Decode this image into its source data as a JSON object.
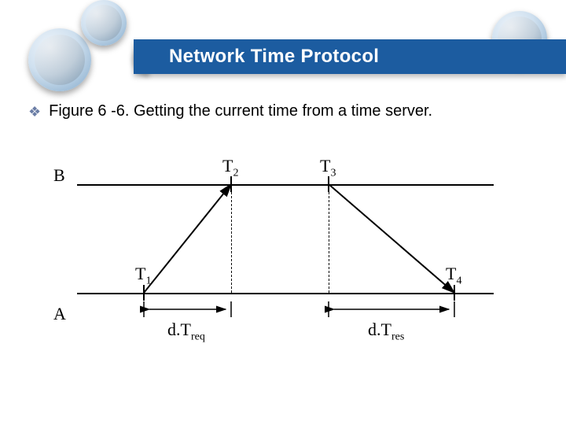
{
  "header": {
    "title": "Network Time Protocol"
  },
  "bullet": {
    "icon": "❖",
    "text": "Figure 6 -6. Getting the current time from a time server."
  },
  "diagram": {
    "node_B": "B",
    "node_A": "A",
    "T1_label": "T",
    "T1_sub": "1",
    "T2_label": "T",
    "T2_sub": "2",
    "T3_label": "T",
    "T3_sub": "3",
    "T4_label": "T",
    "T4_sub": "4",
    "dTreq_label": "d.T",
    "dTreq_sub": "req",
    "dTres_label": "d.T",
    "dTres_sub": "res",
    "geometry": {
      "topLineY": 54,
      "botLineY": 192,
      "leftX": 30,
      "rightX": 560,
      "T1x": 115,
      "T2x": 226,
      "T3x": 350,
      "T4x": 510
    }
  },
  "chart_data": {
    "type": "diagram",
    "description": "Timing diagram (sequence) between client A and server B for NTP round-trip.",
    "timelines": [
      "B",
      "A"
    ],
    "events": [
      {
        "name": "T1",
        "timeline": "A",
        "order": 1
      },
      {
        "name": "T2",
        "timeline": "B",
        "order": 2
      },
      {
        "name": "T3",
        "timeline": "B",
        "order": 3
      },
      {
        "name": "T4",
        "timeline": "A",
        "order": 4
      }
    ],
    "messages": [
      {
        "from": "A",
        "to": "B",
        "depart": "T1",
        "arrive": "T2",
        "label": "d.Treq"
      },
      {
        "from": "B",
        "to": "A",
        "depart": "T3",
        "arrive": "T4",
        "label": "d.Tres"
      }
    ],
    "intervals": [
      {
        "on": "A",
        "start": "T1",
        "end": "T2",
        "label": "d.Treq"
      },
      {
        "on": "A",
        "start": "T3",
        "end": "T4",
        "label": "d.Tres"
      }
    ]
  }
}
